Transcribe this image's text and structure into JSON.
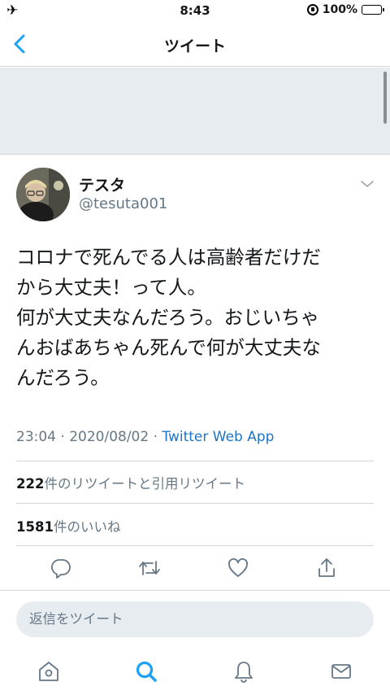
{
  "status_bar": {
    "time": "8:43",
    "battery": "100%",
    "battery_level": 1.0
  },
  "header": {
    "title": "ツイート",
    "back_icon": "chevron-left-icon"
  },
  "tweet": {
    "display_name": "テスタ",
    "handle": "@tesuta001",
    "text_lines": [
      "コロナで死んでる人は高齢者だけだ",
      "から大丈夫！って人。",
      "何が大丈夫なんだろう。おじいちゃ",
      "んおばあちゃん死んで何が大丈夫な",
      "んだろう。"
    ],
    "timestamp": "23:04 · 2020/08/02 · ",
    "source": "Twitter Web App",
    "retweets": {
      "count": "222",
      "label": "件のリツイートと引用リツイート"
    },
    "likes": {
      "count": "1581",
      "label": "件のいいね"
    }
  },
  "actions": [
    "reply-icon",
    "retweet-icon",
    "like-icon",
    "share-icon"
  ],
  "reply": {
    "placeholder": "返信をツイート"
  },
  "tabs": [
    "home-icon",
    "search-icon",
    "notifications-icon",
    "messages-icon"
  ],
  "colors": {
    "accent": "#1da1f2",
    "link": "#1d75c4",
    "text": "#14171a",
    "secondary_text": "#657786",
    "gray_background": "#e6ecf0",
    "divider": "#d4d7da"
  }
}
